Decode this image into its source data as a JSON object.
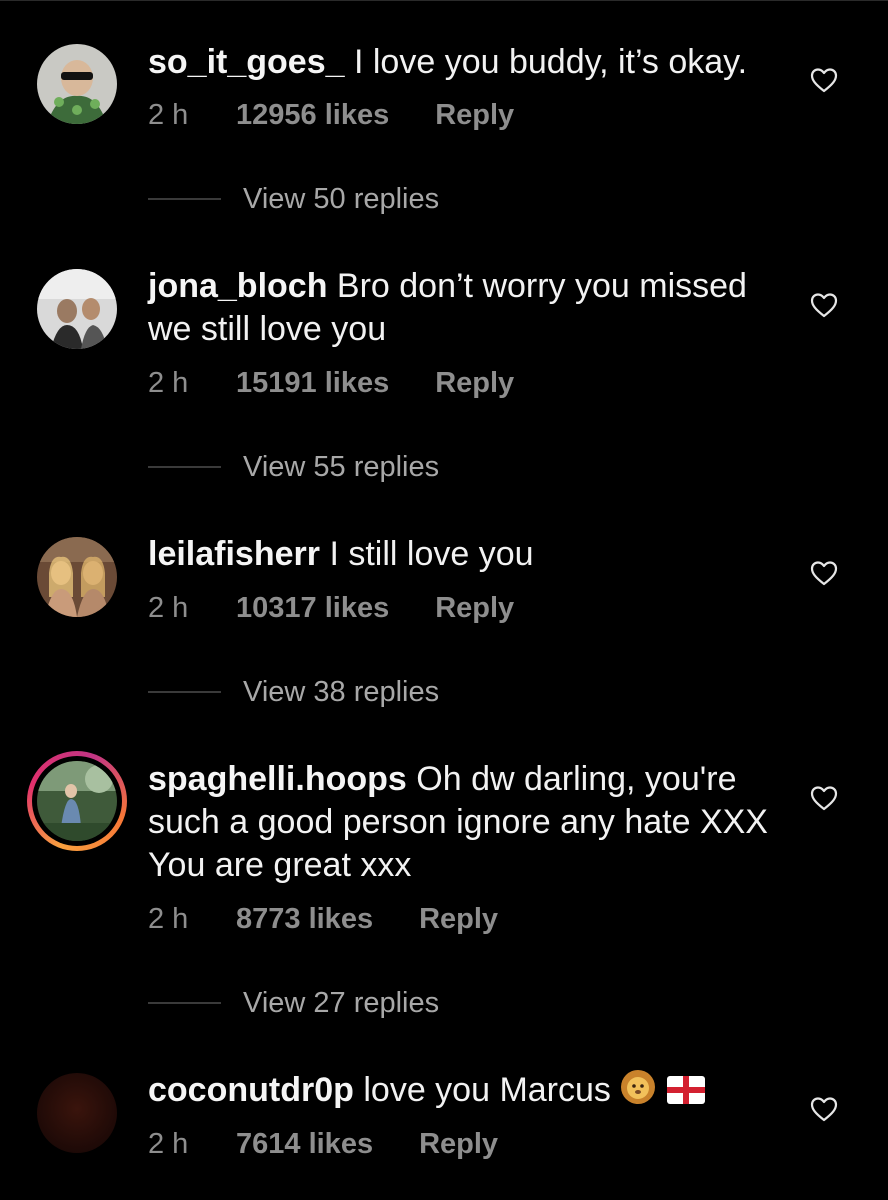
{
  "comments": [
    {
      "username": "so_it_goes_",
      "text": "I love you buddy, it’s okay.",
      "time": "2 h",
      "likes": "12956 likes",
      "reply": "Reply",
      "view_replies": "View 50 replies"
    },
    {
      "username": "jona_bloch",
      "text": "Bro don’t worry you missed we still love you",
      "time": "2 h",
      "likes": "15191 likes",
      "reply": "Reply",
      "view_replies": "View 55 replies"
    },
    {
      "username": "leilafisherr",
      "text": "I still love you",
      "time": "2 h",
      "likes": "10317 likes",
      "reply": "Reply",
      "view_replies": "View 38 replies"
    },
    {
      "username": "spaghelli.hoops",
      "text": "Oh dw darling, you're such a good person ignore any hate XXX You are great xxx",
      "time": "2 h",
      "likes": "8773 likes",
      "reply": "Reply",
      "view_replies": "View 27 replies"
    },
    {
      "username": "coconutdr0p",
      "text": "love you Marcus",
      "time": "2 h",
      "likes": "7614 likes",
      "reply": "Reply"
    }
  ],
  "icons": {
    "like": "heart-outline-icon",
    "lion": "lion-emoji-icon",
    "flag": "england-flag-emoji-icon"
  },
  "colors": {
    "background": "#000000",
    "text": "#f2f2f2",
    "meta": "#8e8e8e"
  }
}
